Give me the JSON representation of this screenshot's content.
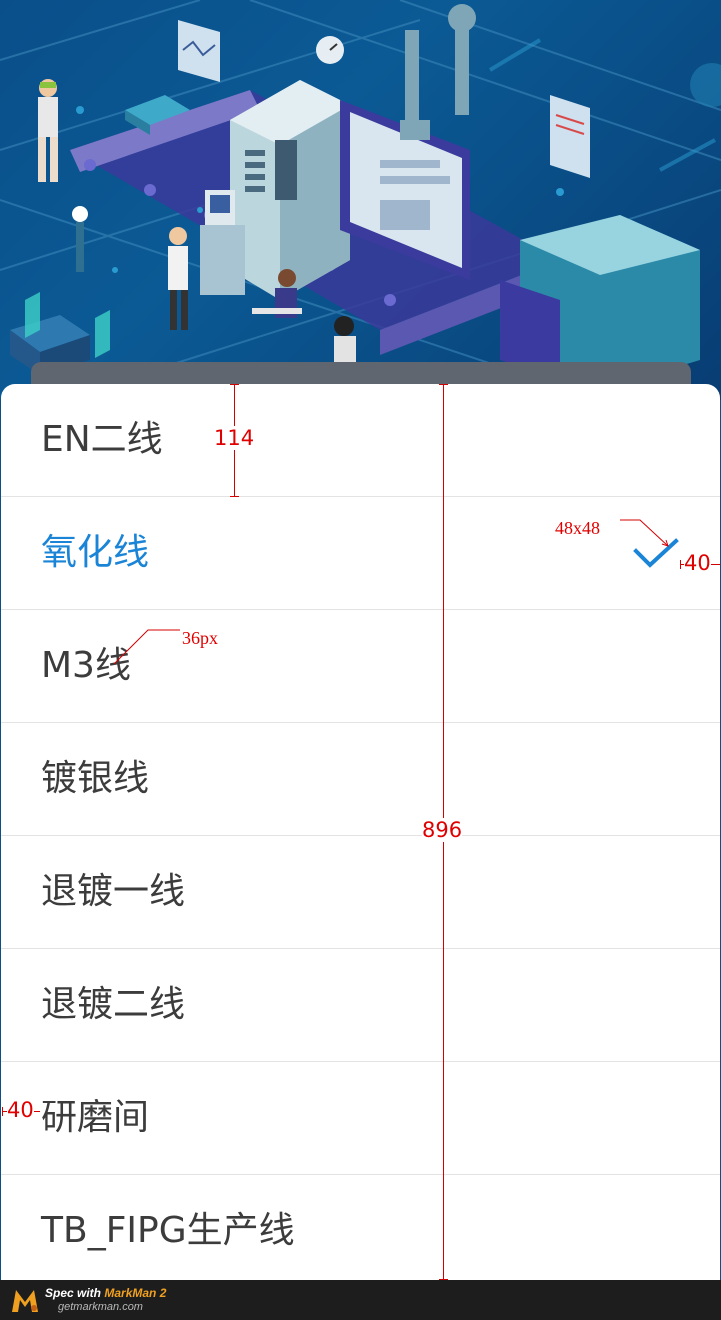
{
  "list": {
    "items": [
      {
        "label": "EN二线",
        "selected": false
      },
      {
        "label": "氧化线",
        "selected": true
      },
      {
        "label": "M3线",
        "selected": false
      },
      {
        "label": "镀银线",
        "selected": false
      },
      {
        "label": "退镀一线",
        "selected": false
      },
      {
        "label": "退镀二线",
        "selected": false
      },
      {
        "label": "研磨间",
        "selected": false
      },
      {
        "label": "TB_FIPG生产线",
        "selected": false
      }
    ],
    "selected_color": "#1a84d6",
    "text_color": "#3c3c3c"
  },
  "annotations": {
    "row_height": "114",
    "sheet_height": "896",
    "icon_size": "48x48",
    "right_margin": "40",
    "font_size": "36px",
    "left_margin": "40"
  },
  "footer": {
    "spec_with": "Spec with",
    "brand": "MarkMan 2",
    "site": "getmarkman.com"
  },
  "icons": {
    "checkmark": "check-icon",
    "logo": "markman-logo-icon"
  }
}
